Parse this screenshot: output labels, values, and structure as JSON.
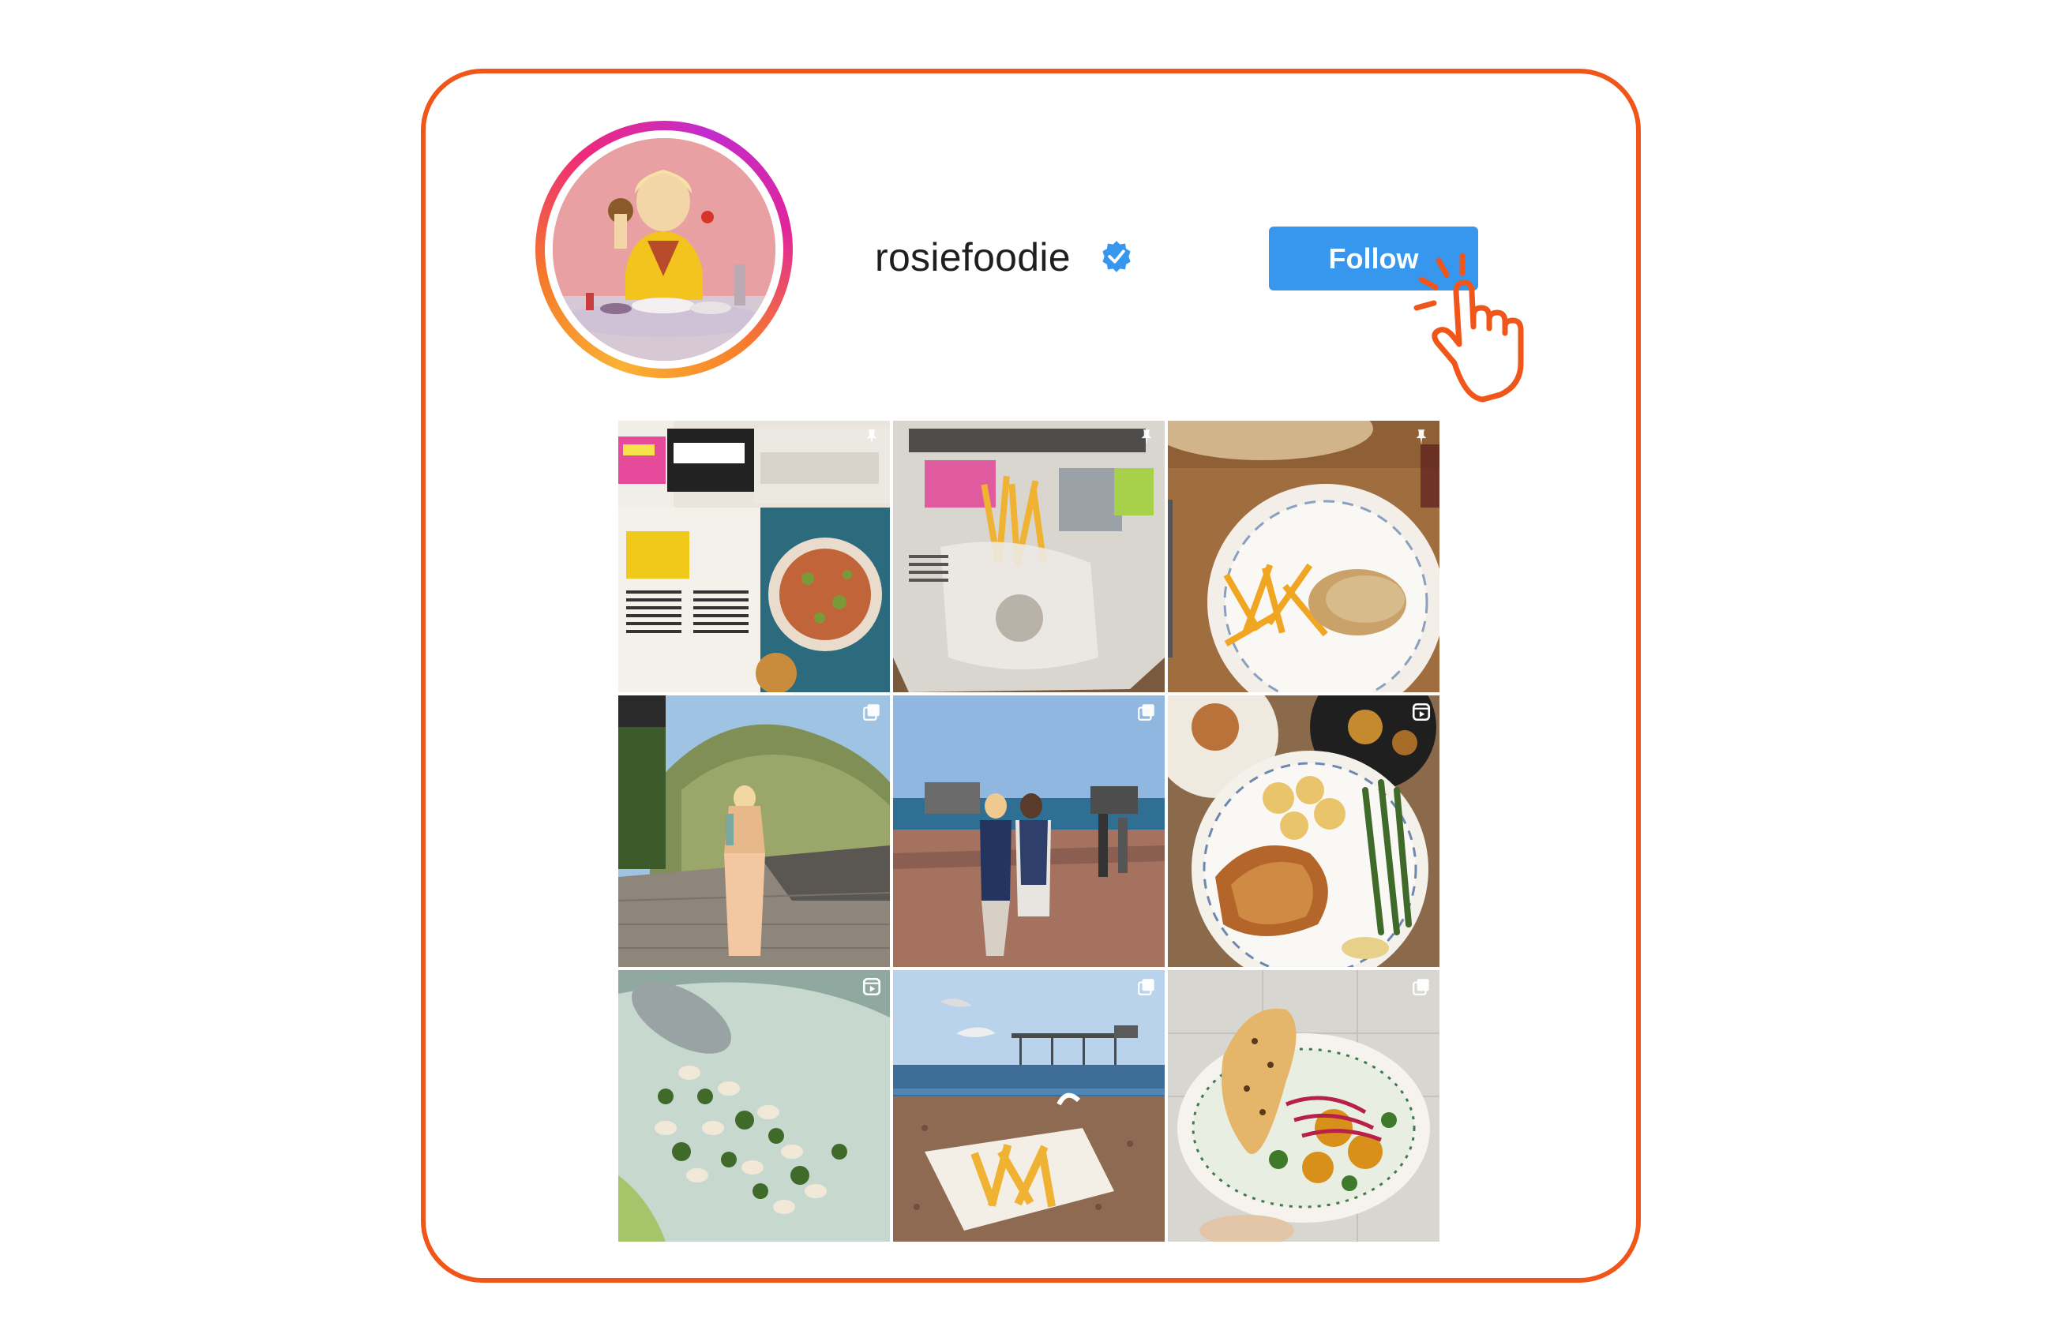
{
  "profile": {
    "username": "rosiefoodie",
    "verified_icon": "verified-badge-icon",
    "follow_label": "Follow"
  },
  "colors": {
    "frame": "#f0561a",
    "follow_button": "#3797ee",
    "verified": "#3797ee"
  },
  "posts": [
    {
      "name": "post-magazine-culture-style",
      "badge": "pin-icon"
    },
    {
      "name": "post-sunday-times-chips",
      "badge": "pin-icon"
    },
    {
      "name": "post-steak-frites",
      "badge": "pin-icon"
    },
    {
      "name": "post-coastal-walk",
      "badge": "carousel-icon"
    },
    {
      "name": "post-pier-couple",
      "badge": "carousel-icon"
    },
    {
      "name": "post-roast-chicken",
      "badge": "reel-icon"
    },
    {
      "name": "post-bean-salad",
      "badge": "reel-icon"
    },
    {
      "name": "post-beach-chips",
      "badge": "carousel-icon"
    },
    {
      "name": "post-curry-bowl",
      "badge": "carousel-icon"
    }
  ]
}
